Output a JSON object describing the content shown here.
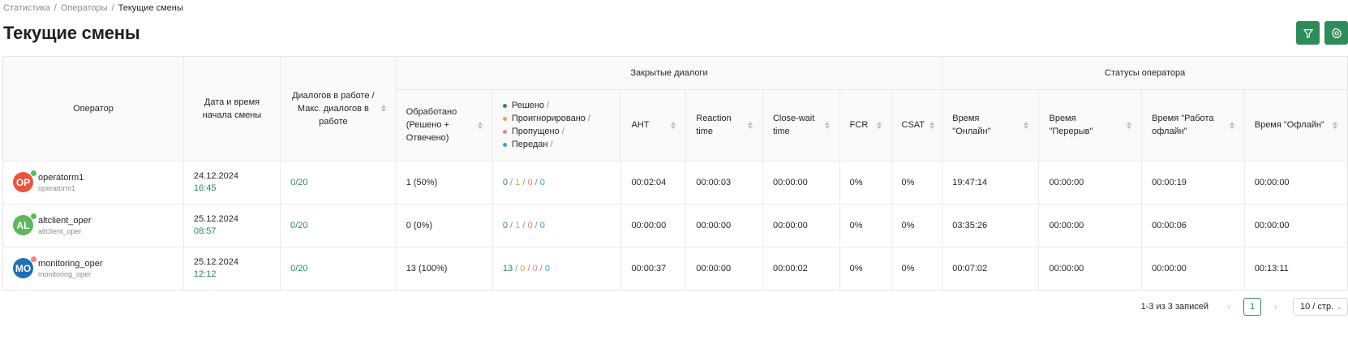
{
  "breadcrumb": {
    "items": [
      "Статистика",
      "Операторы"
    ],
    "current": "Текущие смены"
  },
  "title": "Текущие смены",
  "actions": {
    "filter_icon": "filter-icon",
    "settings_icon": "gear-icon"
  },
  "colors": {
    "accent": "#2e8b5a",
    "resolved": "#2e8b5a",
    "ignored": "#f0a050",
    "missed": "#f08080",
    "transferred": "#3ea0c8"
  },
  "table": {
    "group_headers": {
      "closed_dialogs": "Закрытые диалоги",
      "operator_statuses": "Статусы оператора"
    },
    "columns": {
      "operator": "Оператор",
      "shift_start": "Дата и время начала смены",
      "dialogs_in_work": "Диалогов в работе / Макс. диалогов в работе",
      "processed": "Обработано (Решено + Отвечено)",
      "legend": [
        {
          "label": "Решено",
          "suffix": "/"
        },
        {
          "label": "Проигнорировано",
          "suffix": "/"
        },
        {
          "label": "Пропущено",
          "suffix": "/"
        },
        {
          "label": "Передан",
          "suffix": "/"
        }
      ],
      "aht": "AHT",
      "reaction_time": "Reaction time",
      "close_wait_time": "Close-wait time",
      "fcr": "FCR",
      "csat": "CSAT",
      "time_online": "Время \"Онлайн\"",
      "time_break": "Время \"Перерыв\"",
      "time_work_offline": "Время \"Работа офлайн\"",
      "time_offline": "Время \"Офлайн\""
    },
    "rows": [
      {
        "avatar": "OP",
        "avatar_color": "#e8553f",
        "status_color": "#5cb85c",
        "name": "operatorm1",
        "login": "operatorm1",
        "date": "24.12.2024",
        "time": "16:45",
        "dialogs": "0/20",
        "processed": "1 (50%)",
        "resolved": "0",
        "ignored": "1",
        "missed": "0",
        "transferred": "0",
        "aht": "00:02:04",
        "reaction": "00:00:03",
        "close_wait": "00:00:00",
        "fcr": "0%",
        "csat": "0%",
        "online": "19:47:14",
        "break": "00:00:00",
        "work_offline": "00:00:19",
        "offline": "00:00:00"
      },
      {
        "avatar": "AL",
        "avatar_color": "#5cb85c",
        "status_color": "#5cb85c",
        "name": "altclient_oper",
        "login": "altclient_oper",
        "date": "25.12.2024",
        "time": "08:57",
        "dialogs": "0/20",
        "processed": "0 (0%)",
        "resolved": "0",
        "ignored": "1",
        "missed": "0",
        "transferred": "0",
        "aht": "00:00:00",
        "reaction": "00:00:00",
        "close_wait": "00:00:00",
        "fcr": "0%",
        "csat": "0%",
        "online": "03:35:26",
        "break": "00:00:00",
        "work_offline": "00:00:06",
        "offline": "00:00:00"
      },
      {
        "avatar": "MO",
        "avatar_color": "#1f6fb5",
        "status_color": "#f08080",
        "name": "monitoring_oper",
        "login": "monitoring_oper",
        "date": "25.12.2024",
        "time": "12:12",
        "dialogs": "0/20",
        "processed": "13 (100%)",
        "resolved": "13",
        "ignored": "0",
        "missed": "0",
        "transferred": "0",
        "aht": "00:00:37",
        "reaction": "00:00:00",
        "close_wait": "00:00:02",
        "fcr": "0%",
        "csat": "0%",
        "online": "00:07:02",
        "break": "00:00:00",
        "work_offline": "00:00:00",
        "offline": "00:13:11"
      }
    ]
  },
  "pagination": {
    "total": "1-3 из 3 записей",
    "current_page": "1",
    "page_size": "10 / стр.",
    "prev_icon": "chevron-left-icon",
    "next_icon": "chevron-right-icon"
  }
}
